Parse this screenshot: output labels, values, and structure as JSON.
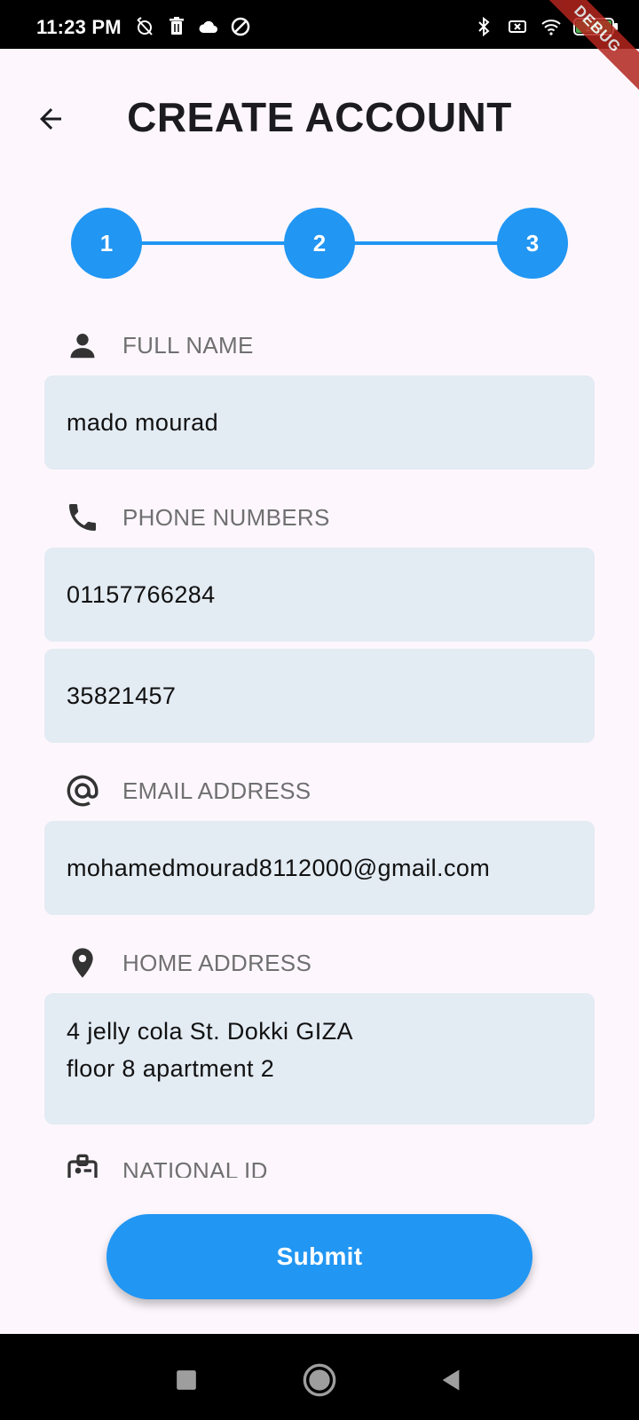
{
  "status_bar": {
    "time": "11:23 PM",
    "left_icons": [
      "alarm-off-icon",
      "trash-icon",
      "cloud-icon",
      "data-saver-icon"
    ],
    "right_icons": [
      "bluetooth-icon",
      "no-sim-icon",
      "wifi-icon",
      "battery-icon"
    ],
    "battery": "100"
  },
  "debug_banner": "DEBUG",
  "header": {
    "back_icon": "arrow-back-icon",
    "title": "CREATE ACCOUNT"
  },
  "stepper": {
    "steps": [
      "1",
      "2",
      "3"
    ],
    "color": "#2196F3"
  },
  "form": {
    "full_name": {
      "label": "FULL NAME",
      "icon": "person-icon",
      "value": "mado mourad"
    },
    "phone_numbers": {
      "label": "PHONE NUMBERS",
      "icon": "phone-icon",
      "values": [
        "01157766284",
        "35821457"
      ]
    },
    "email": {
      "label": "EMAIL ADDRESS",
      "icon": "at-sign-icon",
      "value": "mohamedmourad8112000@gmail.com"
    },
    "home_address": {
      "label": "HOME ADDRESS",
      "icon": "location-pin-icon",
      "lines": [
        "4 jelly cola St. Dokki GIZA",
        "floor 8 apartment 2"
      ]
    },
    "national_id": {
      "label": "NATIONAL ID",
      "icon": "id-badge-icon"
    }
  },
  "submit_label": "Submit",
  "nav_bar": {
    "buttons": [
      "recents-icon",
      "home-icon",
      "back-icon"
    ]
  },
  "colors": {
    "accent": "#2196F3",
    "field_bg": "#E3EBF3",
    "page_bg": "#FDF7FD"
  }
}
